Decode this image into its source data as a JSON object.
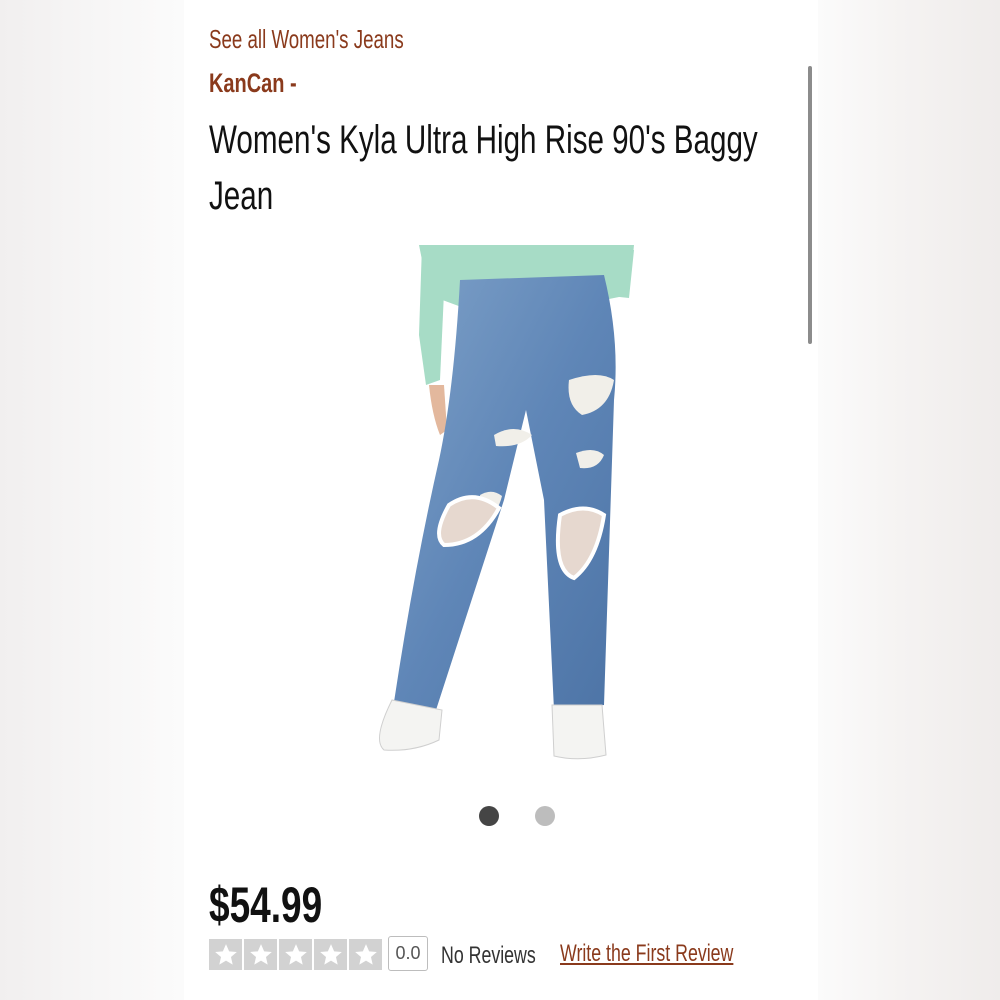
{
  "breadcrumb": {
    "label": "See all Women's Jeans"
  },
  "product": {
    "brand": "KanCan",
    "brand_separator": "-",
    "title": "Women's Kyla Ultra High Rise 90's Baggy Jean",
    "price": "$54.99",
    "image_alt": "Model wearing light-wash distressed baggy jeans with a mint sweater and white sneakers"
  },
  "carousel": {
    "slide_count": 2,
    "active_index": 0
  },
  "rating": {
    "stars_filled": 0,
    "stars_total": 5,
    "score": "0.0",
    "reviews_label": "No Reviews",
    "write_review_label": "Write the First Review"
  },
  "colors": {
    "accent": "#8a3a1c",
    "text": "#111111",
    "star_bg": "#d2d2d2",
    "dot_active": "#454545",
    "dot_inactive": "#bdbdbd"
  },
  "icons": [
    "star-icon"
  ]
}
